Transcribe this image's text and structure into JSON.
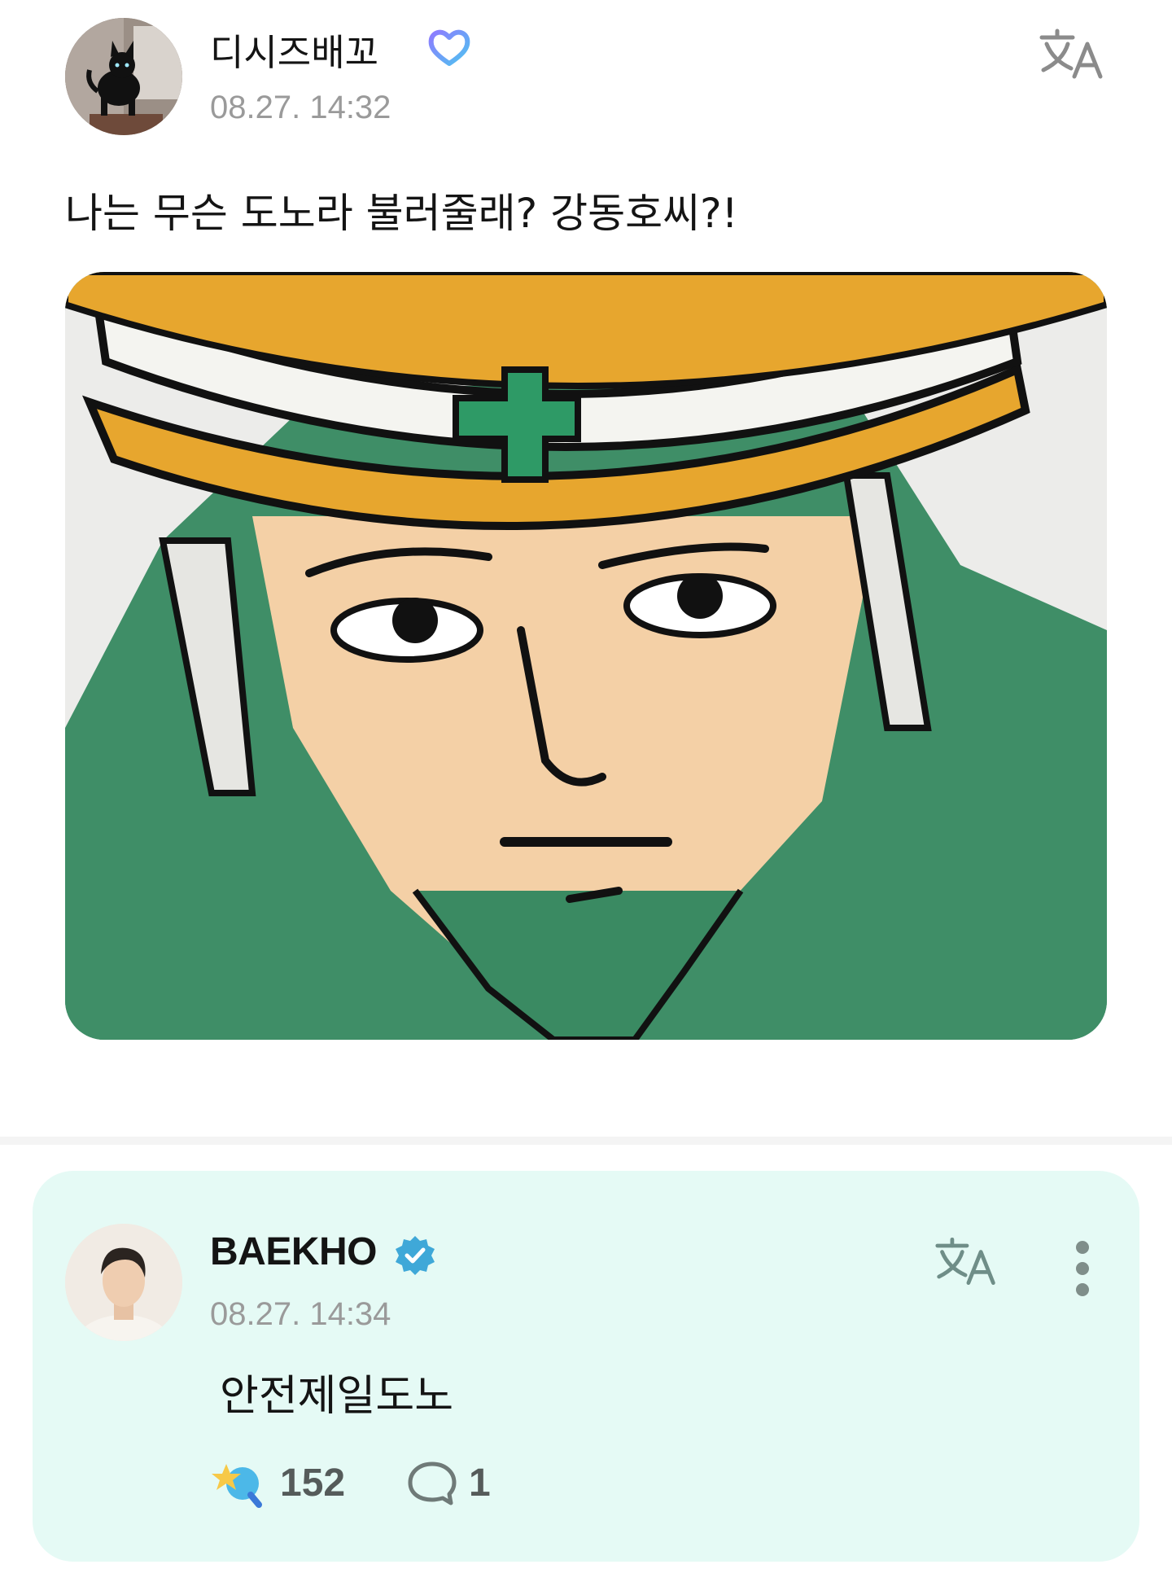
{
  "post": {
    "author": {
      "name": "디시즈배꼬",
      "badge_icon": "membership-heart-badge-icon",
      "avatar_icon": "black-cat-avatar"
    },
    "timestamp": "08.27. 14:32",
    "translate_icon": "translate-icon",
    "text": "나는 무슨 도노라 불러줄래? 강동호씨?!",
    "image_icon": "cartoon-safety-worker-image"
  },
  "reply": {
    "author": {
      "name": "BAEKHO",
      "badge_icon": "verified-badge-icon",
      "avatar_icon": "artist-profile-photo"
    },
    "timestamp": "08.27. 14:34",
    "translate_icon": "translate-icon",
    "more_icon": "more-vertical-icon",
    "text": "안전제일도노",
    "reactions": {
      "icon": "reaction-icon",
      "count": "152"
    },
    "comments": {
      "icon": "comment-bubble-icon",
      "count": "1"
    }
  },
  "colors": {
    "reply_background": "#e5faf5",
    "divider": "#f4f4f4",
    "timestamp": "#9a9a9a",
    "verified_blue": "#3fa8d8",
    "membership_gradient_start": "#8e7bff",
    "membership_gradient_end": "#4ec3f0"
  }
}
